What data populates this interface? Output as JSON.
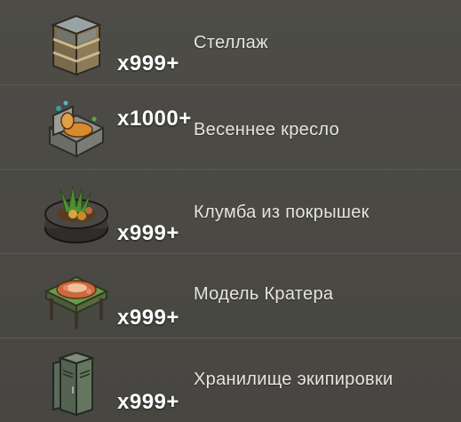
{
  "items": [
    {
      "name": "Стеллаж",
      "quantity": "x999+",
      "icon": "shelving-icon"
    },
    {
      "name": "Весеннее кресло",
      "quantity": "x1000+",
      "icon": "spring-armchair-icon"
    },
    {
      "name": "Клумба из покрышек",
      "quantity": "x999+",
      "icon": "tire-flowerbed-icon"
    },
    {
      "name": "Модель Кратера",
      "quantity": "x999+",
      "icon": "crater-model-icon"
    },
    {
      "name": "Хранилище экипировки",
      "quantity": "x999+",
      "icon": "equipment-locker-icon"
    }
  ]
}
